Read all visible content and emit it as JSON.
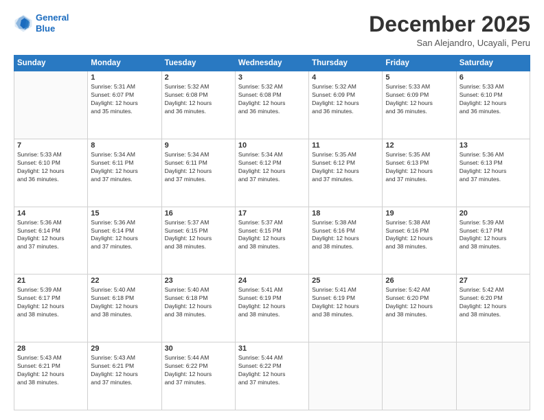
{
  "header": {
    "logo_line1": "General",
    "logo_line2": "Blue",
    "month": "December 2025",
    "location": "San Alejandro, Ucayali, Peru"
  },
  "weekdays": [
    "Sunday",
    "Monday",
    "Tuesday",
    "Wednesday",
    "Thursday",
    "Friday",
    "Saturday"
  ],
  "weeks": [
    [
      {
        "day": "",
        "text": ""
      },
      {
        "day": "1",
        "text": "Sunrise: 5:31 AM\nSunset: 6:07 PM\nDaylight: 12 hours\nand 35 minutes."
      },
      {
        "day": "2",
        "text": "Sunrise: 5:32 AM\nSunset: 6:08 PM\nDaylight: 12 hours\nand 36 minutes."
      },
      {
        "day": "3",
        "text": "Sunrise: 5:32 AM\nSunset: 6:08 PM\nDaylight: 12 hours\nand 36 minutes."
      },
      {
        "day": "4",
        "text": "Sunrise: 5:32 AM\nSunset: 6:09 PM\nDaylight: 12 hours\nand 36 minutes."
      },
      {
        "day": "5",
        "text": "Sunrise: 5:33 AM\nSunset: 6:09 PM\nDaylight: 12 hours\nand 36 minutes."
      },
      {
        "day": "6",
        "text": "Sunrise: 5:33 AM\nSunset: 6:10 PM\nDaylight: 12 hours\nand 36 minutes."
      }
    ],
    [
      {
        "day": "7",
        "text": "Sunrise: 5:33 AM\nSunset: 6:10 PM\nDaylight: 12 hours\nand 36 minutes."
      },
      {
        "day": "8",
        "text": "Sunrise: 5:34 AM\nSunset: 6:11 PM\nDaylight: 12 hours\nand 37 minutes."
      },
      {
        "day": "9",
        "text": "Sunrise: 5:34 AM\nSunset: 6:11 PM\nDaylight: 12 hours\nand 37 minutes."
      },
      {
        "day": "10",
        "text": "Sunrise: 5:34 AM\nSunset: 6:12 PM\nDaylight: 12 hours\nand 37 minutes."
      },
      {
        "day": "11",
        "text": "Sunrise: 5:35 AM\nSunset: 6:12 PM\nDaylight: 12 hours\nand 37 minutes."
      },
      {
        "day": "12",
        "text": "Sunrise: 5:35 AM\nSunset: 6:13 PM\nDaylight: 12 hours\nand 37 minutes."
      },
      {
        "day": "13",
        "text": "Sunrise: 5:36 AM\nSunset: 6:13 PM\nDaylight: 12 hours\nand 37 minutes."
      }
    ],
    [
      {
        "day": "14",
        "text": "Sunrise: 5:36 AM\nSunset: 6:14 PM\nDaylight: 12 hours\nand 37 minutes."
      },
      {
        "day": "15",
        "text": "Sunrise: 5:36 AM\nSunset: 6:14 PM\nDaylight: 12 hours\nand 37 minutes."
      },
      {
        "day": "16",
        "text": "Sunrise: 5:37 AM\nSunset: 6:15 PM\nDaylight: 12 hours\nand 38 minutes."
      },
      {
        "day": "17",
        "text": "Sunrise: 5:37 AM\nSunset: 6:15 PM\nDaylight: 12 hours\nand 38 minutes."
      },
      {
        "day": "18",
        "text": "Sunrise: 5:38 AM\nSunset: 6:16 PM\nDaylight: 12 hours\nand 38 minutes."
      },
      {
        "day": "19",
        "text": "Sunrise: 5:38 AM\nSunset: 6:16 PM\nDaylight: 12 hours\nand 38 minutes."
      },
      {
        "day": "20",
        "text": "Sunrise: 5:39 AM\nSunset: 6:17 PM\nDaylight: 12 hours\nand 38 minutes."
      }
    ],
    [
      {
        "day": "21",
        "text": "Sunrise: 5:39 AM\nSunset: 6:17 PM\nDaylight: 12 hours\nand 38 minutes."
      },
      {
        "day": "22",
        "text": "Sunrise: 5:40 AM\nSunset: 6:18 PM\nDaylight: 12 hours\nand 38 minutes."
      },
      {
        "day": "23",
        "text": "Sunrise: 5:40 AM\nSunset: 6:18 PM\nDaylight: 12 hours\nand 38 minutes."
      },
      {
        "day": "24",
        "text": "Sunrise: 5:41 AM\nSunset: 6:19 PM\nDaylight: 12 hours\nand 38 minutes."
      },
      {
        "day": "25",
        "text": "Sunrise: 5:41 AM\nSunset: 6:19 PM\nDaylight: 12 hours\nand 38 minutes."
      },
      {
        "day": "26",
        "text": "Sunrise: 5:42 AM\nSunset: 6:20 PM\nDaylight: 12 hours\nand 38 minutes."
      },
      {
        "day": "27",
        "text": "Sunrise: 5:42 AM\nSunset: 6:20 PM\nDaylight: 12 hours\nand 38 minutes."
      }
    ],
    [
      {
        "day": "28",
        "text": "Sunrise: 5:43 AM\nSunset: 6:21 PM\nDaylight: 12 hours\nand 38 minutes."
      },
      {
        "day": "29",
        "text": "Sunrise: 5:43 AM\nSunset: 6:21 PM\nDaylight: 12 hours\nand 37 minutes."
      },
      {
        "day": "30",
        "text": "Sunrise: 5:44 AM\nSunset: 6:22 PM\nDaylight: 12 hours\nand 37 minutes."
      },
      {
        "day": "31",
        "text": "Sunrise: 5:44 AM\nSunset: 6:22 PM\nDaylight: 12 hours\nand 37 minutes."
      },
      {
        "day": "",
        "text": ""
      },
      {
        "day": "",
        "text": ""
      },
      {
        "day": "",
        "text": ""
      }
    ]
  ]
}
